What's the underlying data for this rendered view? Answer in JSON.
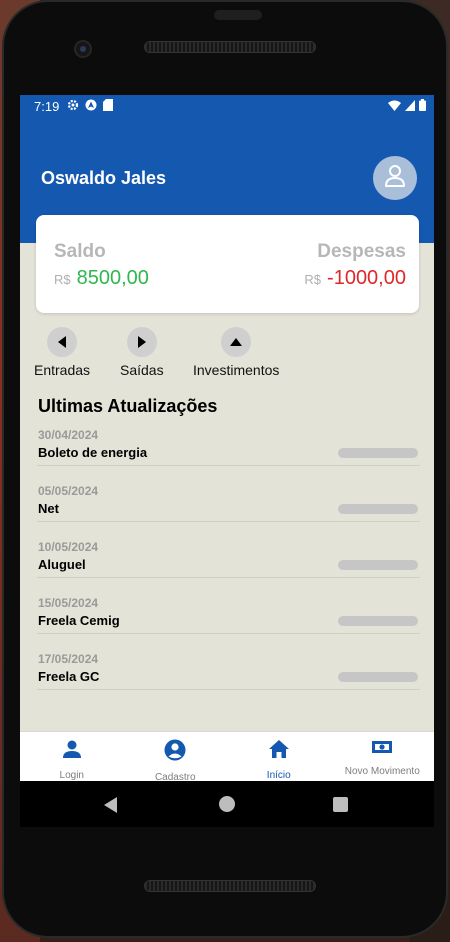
{
  "status_bar": {
    "time": "7:19",
    "left_icons": [
      "gear-icon",
      "android-auto-icon",
      "sd-card-icon"
    ],
    "right_icons": [
      "wifi-icon",
      "signal-icon",
      "battery-icon"
    ]
  },
  "header": {
    "user_name": "Oswaldo Jales",
    "avatar_icon": "user-outline-icon",
    "brand_color": "#1558b0"
  },
  "balance_card": {
    "saldo_label": "Saldo",
    "saldo_currency": "R$",
    "saldo_value": "8500,00",
    "despesas_label": "Despesas",
    "despesas_currency": "R$",
    "despesas_value": "-1000,00",
    "positive_color": "#2eb84f",
    "negative_color": "#e0262a"
  },
  "actions": [
    {
      "label": "Entradas",
      "icon": "caret-left-icon"
    },
    {
      "label": "Saídas",
      "icon": "caret-right-icon"
    },
    {
      "label": "Investimentos",
      "icon": "caret-up-icon"
    }
  ],
  "updates": {
    "title": "Ultimas Atualizações",
    "items": [
      {
        "date": "30/04/2024",
        "name": "Boleto de energia"
      },
      {
        "date": "05/05/2024",
        "name": "Net"
      },
      {
        "date": "10/05/2024",
        "name": "Aluguel"
      },
      {
        "date": "15/05/2024",
        "name": "Freela Cemig"
      },
      {
        "date": "17/05/2024",
        "name": "Freela GC"
      }
    ]
  },
  "tabbar": {
    "tabs": [
      {
        "label": "Login",
        "icon": "person-icon",
        "active": false
      },
      {
        "label": "Cadastro",
        "icon": "account-circle-icon",
        "active": false
      },
      {
        "label": "Início",
        "icon": "home-icon",
        "active": true
      },
      {
        "label": "Novo Movimento",
        "icon": "cash-icon",
        "active": false
      }
    ]
  }
}
